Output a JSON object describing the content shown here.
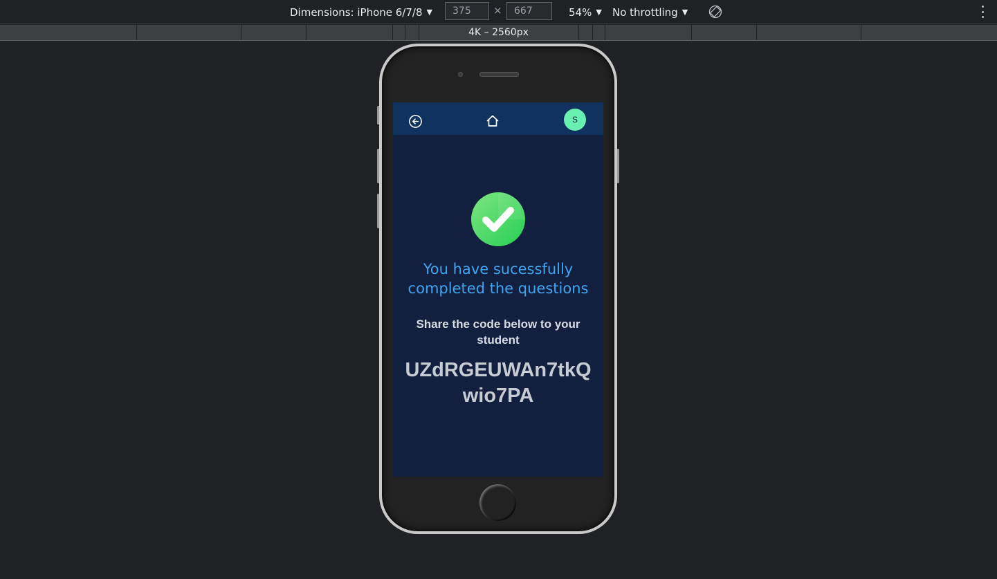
{
  "devtools": {
    "dimensions_label": "Dimensions: iPhone 6/7/8",
    "width_value": "375",
    "height_value": "667",
    "times_symbol": "×",
    "zoom_label": "54%",
    "throttling_label": "No throttling",
    "ruler_label": "4K – 2560px",
    "icons": {
      "dropdown": "triangle-down-icon",
      "rotate": "rotate-icon",
      "more": "kebab-menu-icon"
    }
  },
  "app": {
    "header": {
      "back_icon": "circle-arrow-left-icon",
      "home_icon": "house-icon",
      "avatar_initial": "S",
      "avatar_color": "#67f0b0",
      "background_color": "#10325f"
    },
    "success_icon": "check-circle-icon",
    "success_title": "You have sucessfully completed the questions",
    "share_text": "Share the code below to your student",
    "share_code": "UZdRGEUWAn7tkQwio7PA",
    "colors": {
      "screen_background": "#131f3e",
      "title": "#3fa5f0",
      "check_green": "#35d35e"
    }
  }
}
